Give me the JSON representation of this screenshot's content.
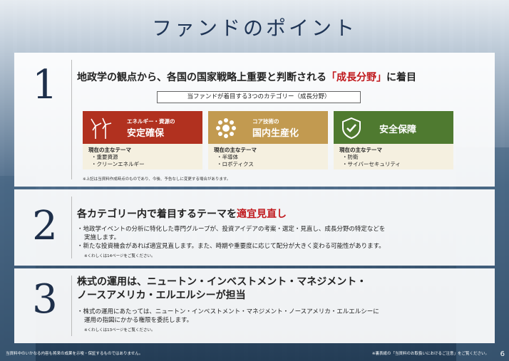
{
  "title": "ファンドのポイント",
  "point1": {
    "number": "1",
    "heading_pre": "地政学の観点から、各国の国家戦略上重要と判断される",
    "heading_accent": "「成長分野」",
    "heading_post": "に着目",
    "category_title": "当ファンドが着目する3つのカテゴリー（成長分野）",
    "cards": [
      {
        "sub": "エネルギー・資源の",
        "main": "安定確保",
        "color": "#b1311f",
        "icon": "wind-turbine-icon",
        "theme_label": "現在の主なテーマ",
        "items": [
          "・重要資源",
          "・クリーンエネルギー"
        ]
      },
      {
        "sub": "コア技術の",
        "main": "国内生産化",
        "color": "#c29a50",
        "icon": "chip-icon",
        "theme_label": "現在の主なテーマ",
        "items": [
          "・半導体",
          "・ロボティクス"
        ]
      },
      {
        "sub": "",
        "main": "安全保障",
        "color": "#4f7a30",
        "icon": "shield-icon",
        "theme_label": "現在の主なテーマ",
        "items": [
          "・防衛",
          "・サイバーセキュリティ"
        ]
      }
    ],
    "note": "※上記は当資料作成時点のものであり、今後、予告なしに変更する場合があります。"
  },
  "point2": {
    "number": "2",
    "heading_pre": "各カテゴリー内で着目するテーマを",
    "heading_accent": "適宜見直し",
    "bullet1a": "・地政学イベントの分析に特化した専門グループが、投資アイデアの考案・選定・見直し、成長分野の特定などを",
    "bullet1b": "実施します。",
    "bullet2": "・新たな投資機会があれば適宜見直します。また、時期や重要度に応じて配分が大きく変わる可能性があります。",
    "ref": "※くわしくは14ページをご覧ください。"
  },
  "point3": {
    "number": "3",
    "heading_line1": "株式の運用は、ニュートン・インベストメント・マネジメント・",
    "heading_line2": "ノースアメリカ・エルエルシーが担当",
    "bullet1a": "・株式の運用にあたっては、ニュートン・インベストメント・マネジメント・ノースアメリカ・エルエルシーに",
    "bullet1b": "運用の指図にかかる権限を委託します。",
    "ref": "※くわしくは13ページをご覧ください。"
  },
  "footer": {
    "left": "当資料中のいかなる内容も将来の成果を示唆・保証するものではありません。",
    "right": "※裏表紙の「当資料のお取扱いにおけるご注意」をご覧ください。",
    "page": "6"
  }
}
